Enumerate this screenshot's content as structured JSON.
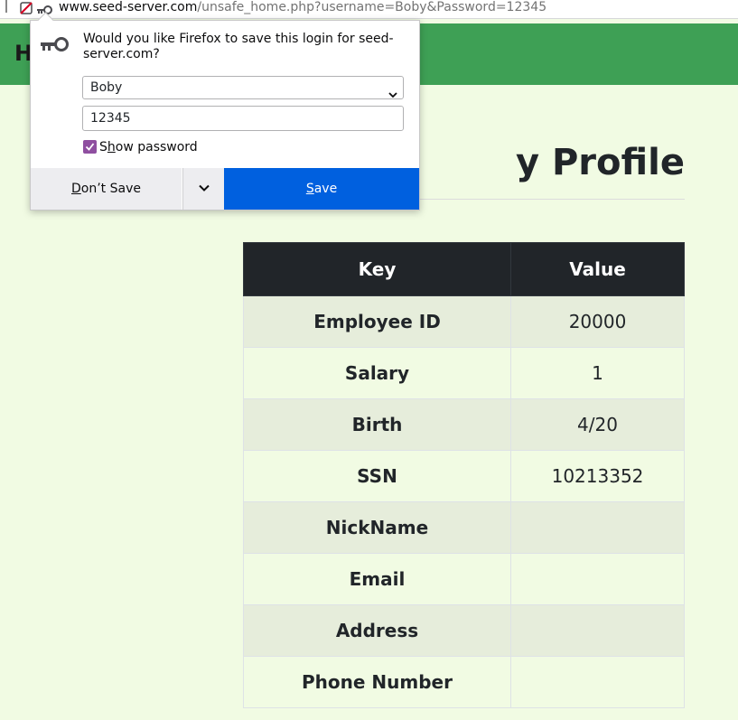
{
  "urlbar": {
    "host": "www.seed-server.com",
    "path": "/unsafe_home.php?username=Boby&Password=12345"
  },
  "navbar": {
    "brand": "H"
  },
  "page": {
    "title": "y Profile"
  },
  "table": {
    "headers": [
      "Key",
      "Value"
    ],
    "rows": [
      {
        "key": "Employee ID",
        "value": "20000"
      },
      {
        "key": "Salary",
        "value": "1"
      },
      {
        "key": "Birth",
        "value": "4/20"
      },
      {
        "key": "SSN",
        "value": "10213352"
      },
      {
        "key": "NickName",
        "value": ""
      },
      {
        "key": "Email",
        "value": ""
      },
      {
        "key": "Address",
        "value": ""
      },
      {
        "key": "Phone Number",
        "value": ""
      }
    ]
  },
  "popup": {
    "message": "Would you like Firefox to save this login for seed-server.com?",
    "username": "Boby",
    "password": "12345",
    "show_password": {
      "first": "S",
      "accel": "h",
      "rest": "ow password",
      "checked": true
    },
    "dont_save": {
      "accel": "D",
      "rest": "on’t Save"
    },
    "save": {
      "accel": "S",
      "rest": "ave"
    }
  },
  "colors": {
    "navbar": "#3ea055",
    "page_bg": "#f1fbe3",
    "save_button": "#0060df",
    "checkbox": "#8f4fa0"
  },
  "icons": [
    "blocked-permission-icon",
    "key-icon",
    "chevron-down-icon",
    "checkmark-icon"
  ]
}
